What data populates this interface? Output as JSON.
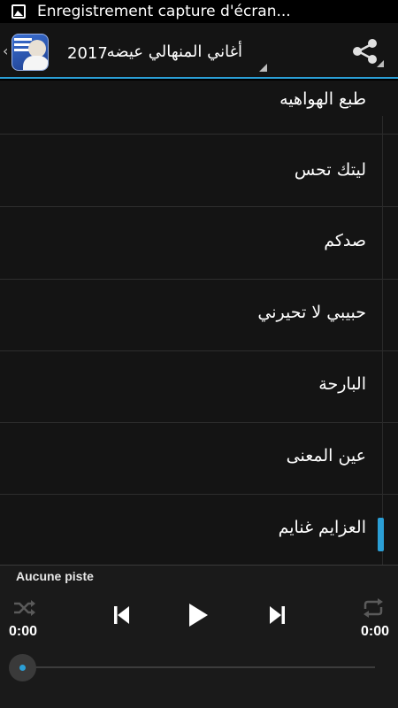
{
  "status_bar": {
    "icon": "screenshot-gallery-icon",
    "text": "Enregistrement capture d'écran..."
  },
  "action_bar": {
    "up_icon": "‹",
    "title_arabic": "أغاني المنهالي عيضه",
    "title_year": "2017",
    "share_icon": "share-icon"
  },
  "songs": [
    {
      "label": "طبع الهواهيه"
    },
    {
      "label": "ليتك تحس"
    },
    {
      "label": "صدكم"
    },
    {
      "label": "حبيبي لا تحيرني"
    },
    {
      "label": "البارحة"
    },
    {
      "label": "عين المعنى"
    },
    {
      "label": "العزايم غنايم"
    }
  ],
  "player": {
    "track_name": "Aucune piste",
    "elapsed": "0:00",
    "duration": "0:00",
    "progress": 0,
    "icons": {
      "shuffle": "shuffle-icon",
      "previous": "skip-previous-icon",
      "play": "play-icon",
      "next": "skip-next-icon",
      "repeat": "repeat-icon"
    }
  },
  "colors": {
    "accent": "#2b9fd6",
    "background": "#141414",
    "player_bg": "#1a1a1a"
  }
}
